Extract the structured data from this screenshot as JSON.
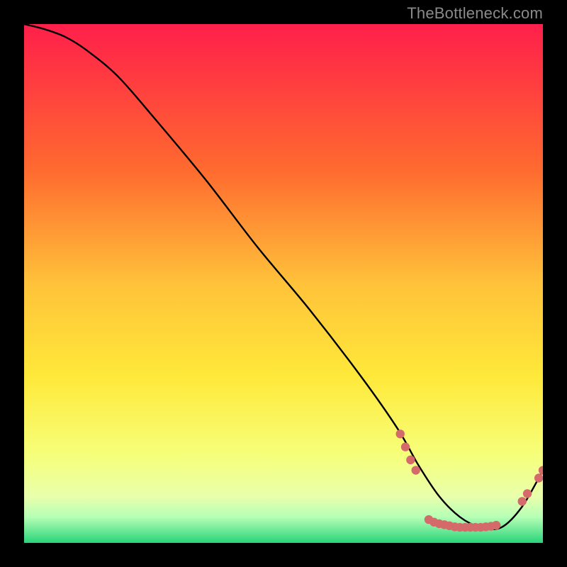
{
  "watermark": "TheBottleneck.com",
  "colors": {
    "dot": "#d46a6a",
    "line": "#000000",
    "bg": "#000000",
    "grad_top": "#ff1f4b",
    "grad_mid_upper": "#ff9a2a",
    "grad_mid": "#ffe93a",
    "grad_lower": "#f6ff7a",
    "grad_green_top": "#b6ffb6",
    "grad_green": "#28d47a"
  },
  "chart_data": {
    "type": "line",
    "title": "",
    "xlabel": "",
    "ylabel": "",
    "xlim": [
      0,
      100
    ],
    "ylim": [
      0,
      100
    ],
    "series": [
      {
        "name": "curve",
        "x": [
          0,
          4,
          8,
          12,
          18,
          25,
          35,
          45,
          55,
          65,
          72,
          76,
          80,
          84,
          88,
          92,
          96,
          100
        ],
        "y": [
          100,
          99,
          97.5,
          95,
          90,
          82,
          70,
          57,
          45,
          32,
          22,
          15,
          9,
          5,
          3,
          3,
          7,
          14
        ]
      }
    ],
    "highlight_points": [
      {
        "x": 72.5,
        "y": 21
      },
      {
        "x": 73.5,
        "y": 18.5
      },
      {
        "x": 74.5,
        "y": 16
      },
      {
        "x": 75.5,
        "y": 14
      },
      {
        "x": 78,
        "y": 4.5
      },
      {
        "x": 79,
        "y": 4
      },
      {
        "x": 80,
        "y": 3.7
      },
      {
        "x": 81,
        "y": 3.5
      },
      {
        "x": 82,
        "y": 3.3
      },
      {
        "x": 83,
        "y": 3.1
      },
      {
        "x": 84,
        "y": 3
      },
      {
        "x": 85,
        "y": 3
      },
      {
        "x": 86,
        "y": 3
      },
      {
        "x": 87,
        "y": 3
      },
      {
        "x": 88,
        "y": 3
      },
      {
        "x": 89,
        "y": 3.1
      },
      {
        "x": 90,
        "y": 3.2
      },
      {
        "x": 91,
        "y": 3.4
      },
      {
        "x": 96,
        "y": 8
      },
      {
        "x": 97,
        "y": 9.5
      },
      {
        "x": 99.2,
        "y": 12.5
      },
      {
        "x": 100,
        "y": 14
      }
    ]
  }
}
